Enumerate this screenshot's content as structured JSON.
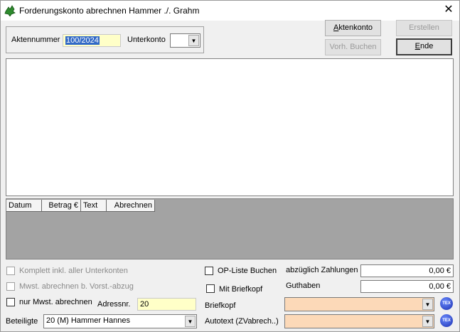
{
  "window": {
    "title": "Forderungskonto abrechnen Hammer ./. Grahm",
    "close_glyph": "✕"
  },
  "header": {
    "aktennummer_label": "Aktennummer",
    "aktennummer_value": "100/2024",
    "unterkonto_label": "Unterkonto",
    "unterkonto_value": ""
  },
  "buttons": {
    "aktenkonto_pre": "",
    "aktenkonto_u": "A",
    "aktenkonto_post": "ktenkonto",
    "erstellen": "Erstellen",
    "vorh_buchen": "Vorh. Buchen",
    "ende_pre": "",
    "ende_u": "E",
    "ende_post": "nde"
  },
  "grid": {
    "columns": [
      "Datum",
      "Betrag €",
      "Text",
      "Abrechnen"
    ]
  },
  "options": {
    "komplett": "Komplett inkl. aller Unterkonten",
    "mwst_vorst": "Mwst. abrechnen b. Vorst.-abzug",
    "nur_mwst": "nur Mwst. abrechnen",
    "op_liste": "OP-Liste Buchen",
    "mit_briefkopf": "Mit Briefkopf"
  },
  "fields": {
    "adressnr_label": "Adressnr.",
    "adressnr_value": "20",
    "beteiligte_label": "Beteiligte",
    "beteiligte_value": "20 (M) Hammer Hannes",
    "briefkopf_label": "Briefkopf",
    "briefkopf_value": "",
    "autotext_label": "Autotext (ZVabrech..)",
    "autotext_value": "",
    "abzueglich_label": "abzüglich Zahlungen",
    "abzueglich_value": "0,00 €",
    "guthaben_label": "Guthaben",
    "guthaben_value": "0,00 €"
  },
  "icons": {
    "app": "green-leaf-icon",
    "tex": "tex-icon",
    "tex_text": "TEX"
  },
  "colors": {
    "selection": "#3169c6",
    "input_yellow": "#ffffc8",
    "combo_peach": "#fcd9b8",
    "grid_bg": "#a3a3a3"
  }
}
